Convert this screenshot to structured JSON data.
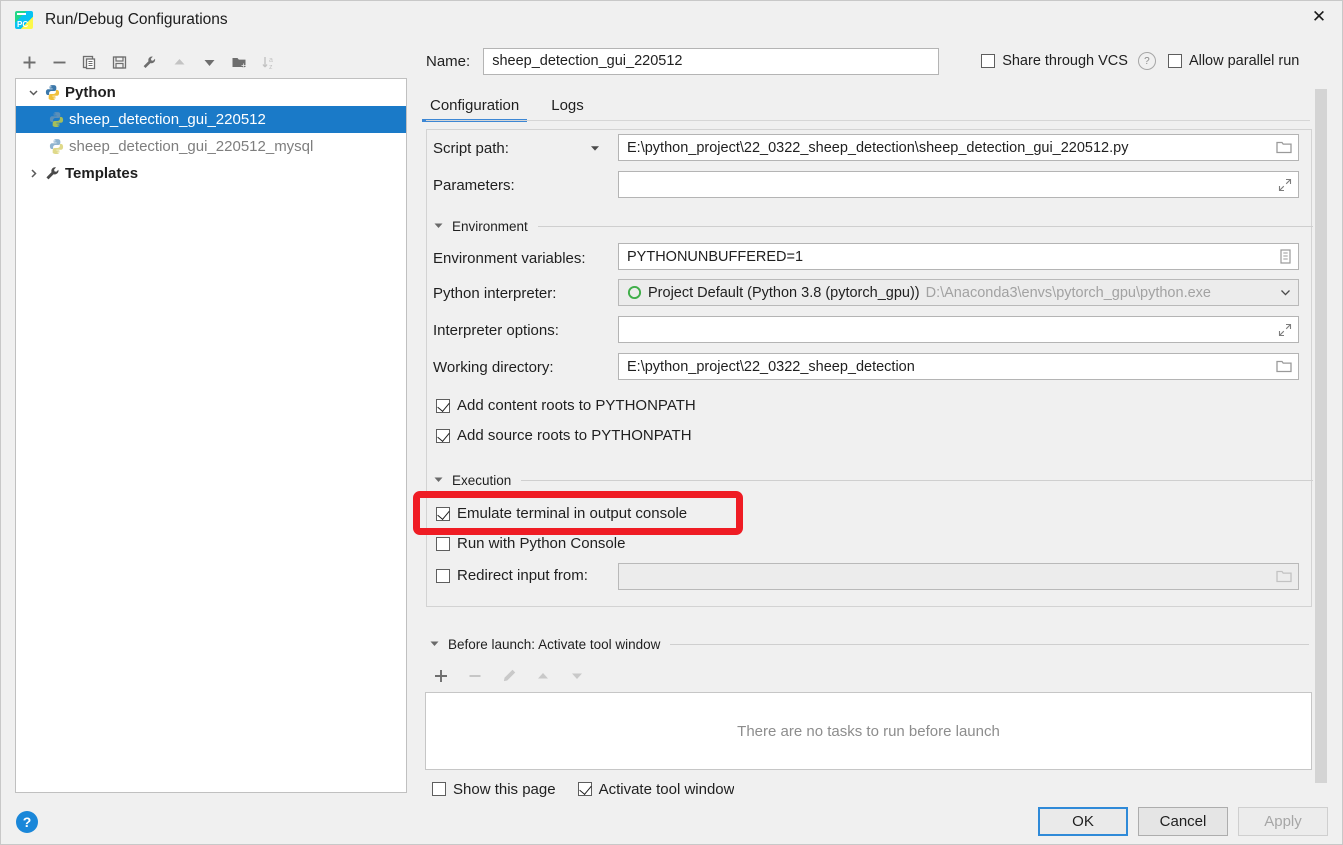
{
  "window": {
    "title": "Run/Debug Configurations",
    "close_icon": "close-icon",
    "app_icon": "pycharm-logo"
  },
  "left_panel": {
    "toolbar": [
      {
        "name": "add-configuration-button",
        "icon": "plus-icon",
        "enabled": true
      },
      {
        "name": "remove-configuration-button",
        "icon": "minus-icon",
        "enabled": true
      },
      {
        "name": "copy-configuration-button",
        "icon": "copy-icon",
        "enabled": true
      },
      {
        "name": "save-configuration-button",
        "icon": "save-icon",
        "enabled": true
      },
      {
        "name": "edit-templates-button",
        "icon": "wrench-icon",
        "enabled": true
      },
      {
        "name": "move-up-button",
        "icon": "arrow-up-icon",
        "enabled": false
      },
      {
        "name": "move-down-button",
        "icon": "arrow-down-icon",
        "enabled": true
      },
      {
        "name": "new-folder-button",
        "icon": "folder-add-icon",
        "enabled": true
      },
      {
        "name": "sort-configurations-button",
        "icon": "sort-az-icon",
        "enabled": false
      }
    ],
    "tree": [
      {
        "label": "Python",
        "icon": "python-icon",
        "level": 0,
        "twisty": "expanded",
        "bold": true,
        "selected": false,
        "dim": false
      },
      {
        "label": "sheep_detection_gui_220512",
        "icon": "python-icon",
        "level": 1,
        "twisty": "none",
        "bold": false,
        "selected": true,
        "dim": false
      },
      {
        "label": "sheep_detection_gui_220512_mysql",
        "icon": "python-icon",
        "level": 1,
        "twisty": "none",
        "bold": false,
        "selected": false,
        "dim": true
      },
      {
        "label": "Templates",
        "icon": "wrench-icon",
        "level": 0,
        "twisty": "collapsed",
        "bold": true,
        "selected": false,
        "dim": false
      }
    ]
  },
  "header": {
    "name_label": "Name:",
    "name_value": "sheep_detection_gui_220512",
    "share_vcs_label": "Share through VCS",
    "share_vcs_checked": false,
    "help_icon": "question-mark-icon",
    "allow_parallel_label": "Allow parallel run",
    "allow_parallel_checked": false
  },
  "tabs": [
    {
      "label": "Configuration",
      "active": true
    },
    {
      "label": "Logs",
      "active": false
    }
  ],
  "form": {
    "script_path": {
      "label": "Script path:",
      "value": "E:\\python_project\\22_0322_sheep_detection\\sheep_detection_gui_220512.py",
      "dropdown_icon": "chevron-down-icon",
      "browse_icon": "folder-icon"
    },
    "parameters": {
      "label": "Parameters:",
      "value": "",
      "expand_icon": "expand-icon"
    },
    "environment_section": {
      "title": "Environment",
      "twisty": "expanded"
    },
    "environment_variables": {
      "label": "Environment variables:",
      "value": "PYTHONUNBUFFERED=1",
      "browse_icon": "list-edit-icon"
    },
    "python_interpreter": {
      "label": "Python interpreter:",
      "value": "Project Default (Python 3.8 (pytorch_gpu))",
      "path_hint": "D:\\Anaconda3\\envs\\pytorch_gpu\\python.exe",
      "status_icon": "python-env-circle-icon",
      "dropdown_icon": "chevron-down-icon"
    },
    "interpreter_options": {
      "label": "Interpreter options:",
      "value": "",
      "expand_icon": "expand-icon"
    },
    "working_directory": {
      "label": "Working directory:",
      "value": "E:\\python_project\\22_0322_sheep_detection",
      "browse_icon": "folder-icon"
    },
    "add_content_roots": {
      "label": "Add content roots to PYTHONPATH",
      "checked": true
    },
    "add_source_roots": {
      "label": "Add source roots to PYTHONPATH",
      "checked": true
    },
    "execution_section": {
      "title": "Execution",
      "twisty": "expanded"
    },
    "emulate_terminal": {
      "label": "Emulate terminal in output console",
      "checked": true,
      "highlighted": true
    },
    "run_with_python_console": {
      "label": "Run with Python Console",
      "checked": false
    },
    "redirect_input": {
      "label": "Redirect input from:",
      "checked": false,
      "value": "",
      "browse_icon": "folder-icon"
    }
  },
  "before_launch": {
    "section_title": "Before launch: Activate tool window",
    "twisty": "expanded",
    "toolbar": [
      {
        "name": "add-task-button",
        "icon": "plus-icon",
        "enabled": true
      },
      {
        "name": "remove-task-button",
        "icon": "minus-icon",
        "enabled": false
      },
      {
        "name": "edit-task-button",
        "icon": "pencil-icon",
        "enabled": false
      },
      {
        "name": "task-move-up-button",
        "icon": "arrow-up-icon",
        "enabled": false
      },
      {
        "name": "task-move-down-button",
        "icon": "arrow-down-icon",
        "enabled": false
      }
    ],
    "empty_text": "There are no tasks to run before launch",
    "show_this_page": {
      "label": "Show this page",
      "checked": false
    },
    "activate_tool_window": {
      "label": "Activate tool window",
      "checked": true
    }
  },
  "footer": {
    "help_icon": "help-icon",
    "ok_label": "OK",
    "cancel_label": "Cancel",
    "apply_label": "Apply",
    "apply_enabled": false
  },
  "annotation": {
    "highlight_color": "#ef1c24",
    "target": "emulate-terminal-in-output-console"
  },
  "colors": {
    "selection_blue": "#1a7ac8",
    "tab_underline": "#3d87d4",
    "dialog_bg": "#f0f0f0",
    "field_bg": "#ffffff"
  }
}
